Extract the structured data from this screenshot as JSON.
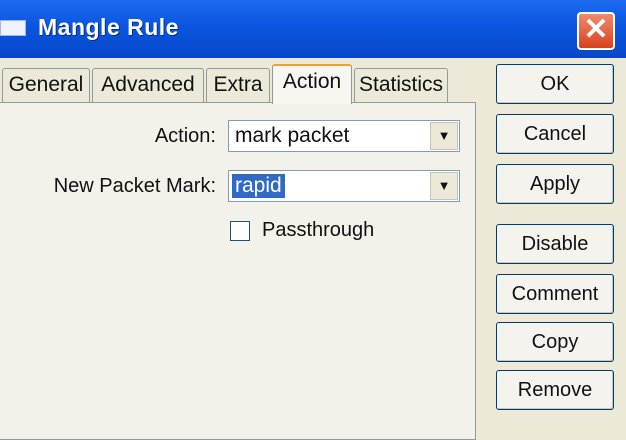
{
  "window": {
    "title": "Mangle Rule",
    "close_glyph": "✕"
  },
  "tabs": [
    {
      "label": "General"
    },
    {
      "label": "Advanced"
    },
    {
      "label": "Extra"
    },
    {
      "label": "Action",
      "active": true
    },
    {
      "label": "Statistics"
    }
  ],
  "form": {
    "action_label": "Action:",
    "action_value": "mark packet",
    "packet_mark_label": "New Packet Mark:",
    "packet_mark_value": "rapid",
    "passthrough_label": "Passthrough",
    "passthrough_checked": false,
    "dropdown_glyph": "▼"
  },
  "buttons": {
    "ok": "OK",
    "cancel": "Cancel",
    "apply": "Apply",
    "disable": "Disable",
    "comment": "Comment",
    "copy": "Copy",
    "remove": "Remove"
  },
  "colors": {
    "titlebar": "#0a55e0",
    "close": "#d9411c",
    "selection": "#316ac5",
    "active_tab_top": "#e9a23a"
  }
}
